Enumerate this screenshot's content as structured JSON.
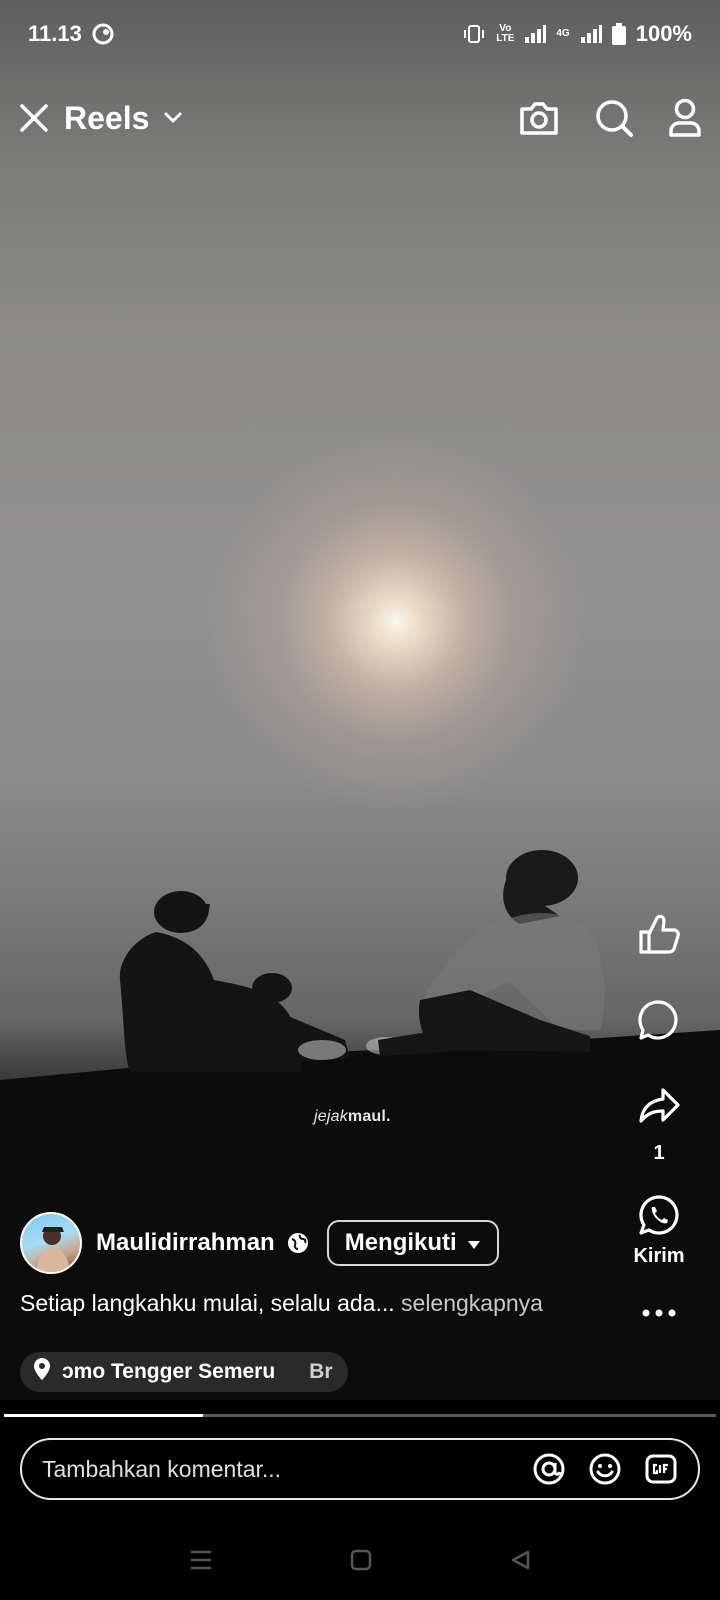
{
  "status_bar": {
    "time": "11.13",
    "network_top": "Vo",
    "network_bottom": "LTE",
    "signal_label": "4G",
    "battery": "100%"
  },
  "header": {
    "title": "Reels",
    "icons": [
      "close-icon",
      "chevron-down-icon",
      "camera-icon",
      "search-icon",
      "profile-icon"
    ]
  },
  "video": {
    "watermark_italic": "jejak",
    "watermark_bold": "maul."
  },
  "actions": {
    "share_count": "1",
    "send_label": "Kirim"
  },
  "author": {
    "name": "Maulidirrahman",
    "follow_label": "Mengikuti"
  },
  "caption": {
    "text": "Setiap langkahku mulai, selalu ada...",
    "more": "selengkapnya"
  },
  "location": {
    "text": "ɔmo Tengger Semeru",
    "next": "Br"
  },
  "progress": {
    "fraction": 0.28
  },
  "comment": {
    "placeholder": "Tambahkan komentar..."
  },
  "colors": {
    "background": "#000000",
    "text": "#ffffff",
    "chip": "#2a2a2a"
  }
}
